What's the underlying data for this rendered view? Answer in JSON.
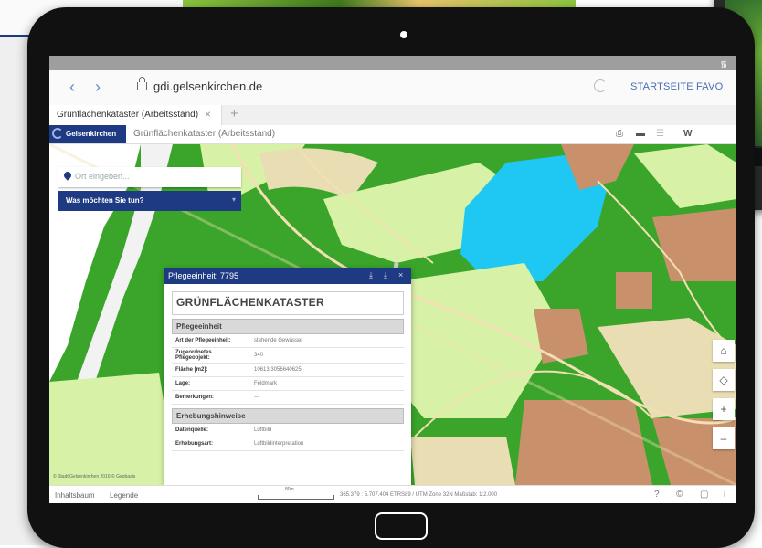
{
  "browser": {
    "url": "gdi.gelsenkirchen.de",
    "nav_back": "‹",
    "nav_forward": "›",
    "links": [
      "STARTSEITE",
      "FAVO"
    ]
  },
  "tab": {
    "label": "Grünflächenkataster (Arbeitsstand)",
    "close": "×",
    "add": "+"
  },
  "app": {
    "logo": "Gelsenkirchen",
    "title": "Grünflächenkataster (Arbeitsstand)",
    "header_icons": [
      "print-icon",
      "minus-icon",
      "menu-icon"
    ],
    "header_tail": "W"
  },
  "search": {
    "placeholder": "Ort eingeben..."
  },
  "action": {
    "label": "Was möchten Sie tun?",
    "caret": "▾"
  },
  "popup": {
    "title": "Pflegeeinheit: 7795",
    "heading": "GRÜNFLÄCHENKATASTER",
    "section1": "Pflegeeinheit",
    "rows1": [
      {
        "k": "Art der Pflegeeinheit:",
        "v": "stehende Gewässer"
      },
      {
        "k": "Zugeordnetes Pflegeobjekt:",
        "v": "340"
      },
      {
        "k": "Fläche [m2]:",
        "v": "10613,3056640625"
      },
      {
        "k": "Lage:",
        "v": "Feldmark"
      },
      {
        "k": "Bemerkungen:",
        "v": "---"
      }
    ],
    "section2": "Erhebungshinweise",
    "rows2": [
      {
        "k": "Datenquelle:",
        "v": "Luftbild"
      },
      {
        "k": "Erhebungsart:",
        "v": "Luftbildinterpretation"
      }
    ]
  },
  "map_controls": [
    "⌂",
    "◇",
    "+",
    "–"
  ],
  "copyright": "© Stadt Gelsenkirchen 2016 © Geobasis",
  "footer": {
    "inhaltsbaum": "Inhaltsbaum",
    "legende": "Legende",
    "scale": "80m",
    "coords": "365.379 : 5.707.404   ETRS89 / UTM Zone 32N   Maßstab: 1:2.000",
    "icons": [
      "?",
      "©",
      "▢",
      "i"
    ]
  },
  "colors": {
    "primary": "#1e3a82",
    "map_green": "#3aa52a",
    "map_light_green": "#d7f2a6",
    "map_brown": "#c8906b",
    "map_water": "#1ec8f2",
    "link": "#4a6db4"
  }
}
